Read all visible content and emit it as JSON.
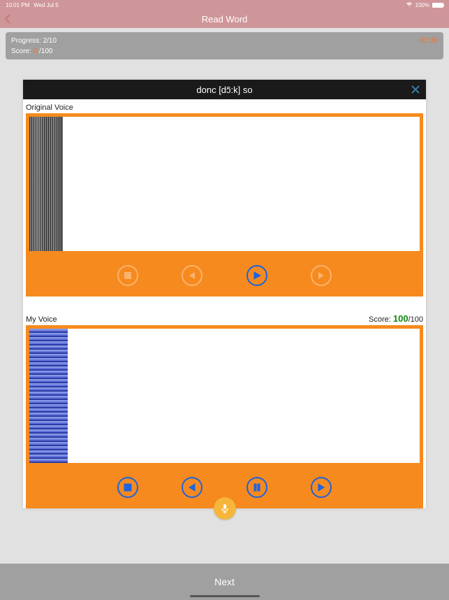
{
  "status": {
    "time": "10:01 PM",
    "date": "Wed Jul 5",
    "battery_pct": "100%"
  },
  "nav": {
    "title": "Read Word"
  },
  "info": {
    "progress_label": "Progress:",
    "progress_value": "2/10",
    "timer": "00:39",
    "score_label": "Score:",
    "score_current": "0",
    "score_total": "/100"
  },
  "card": {
    "title": "donc [dɔ̃:k] so",
    "original_label": "Original Voice",
    "my_label": "My Voice",
    "my_score_label": "Score:",
    "my_score_value": "100",
    "my_score_total": "/100"
  },
  "footer": {
    "next": "Next"
  }
}
